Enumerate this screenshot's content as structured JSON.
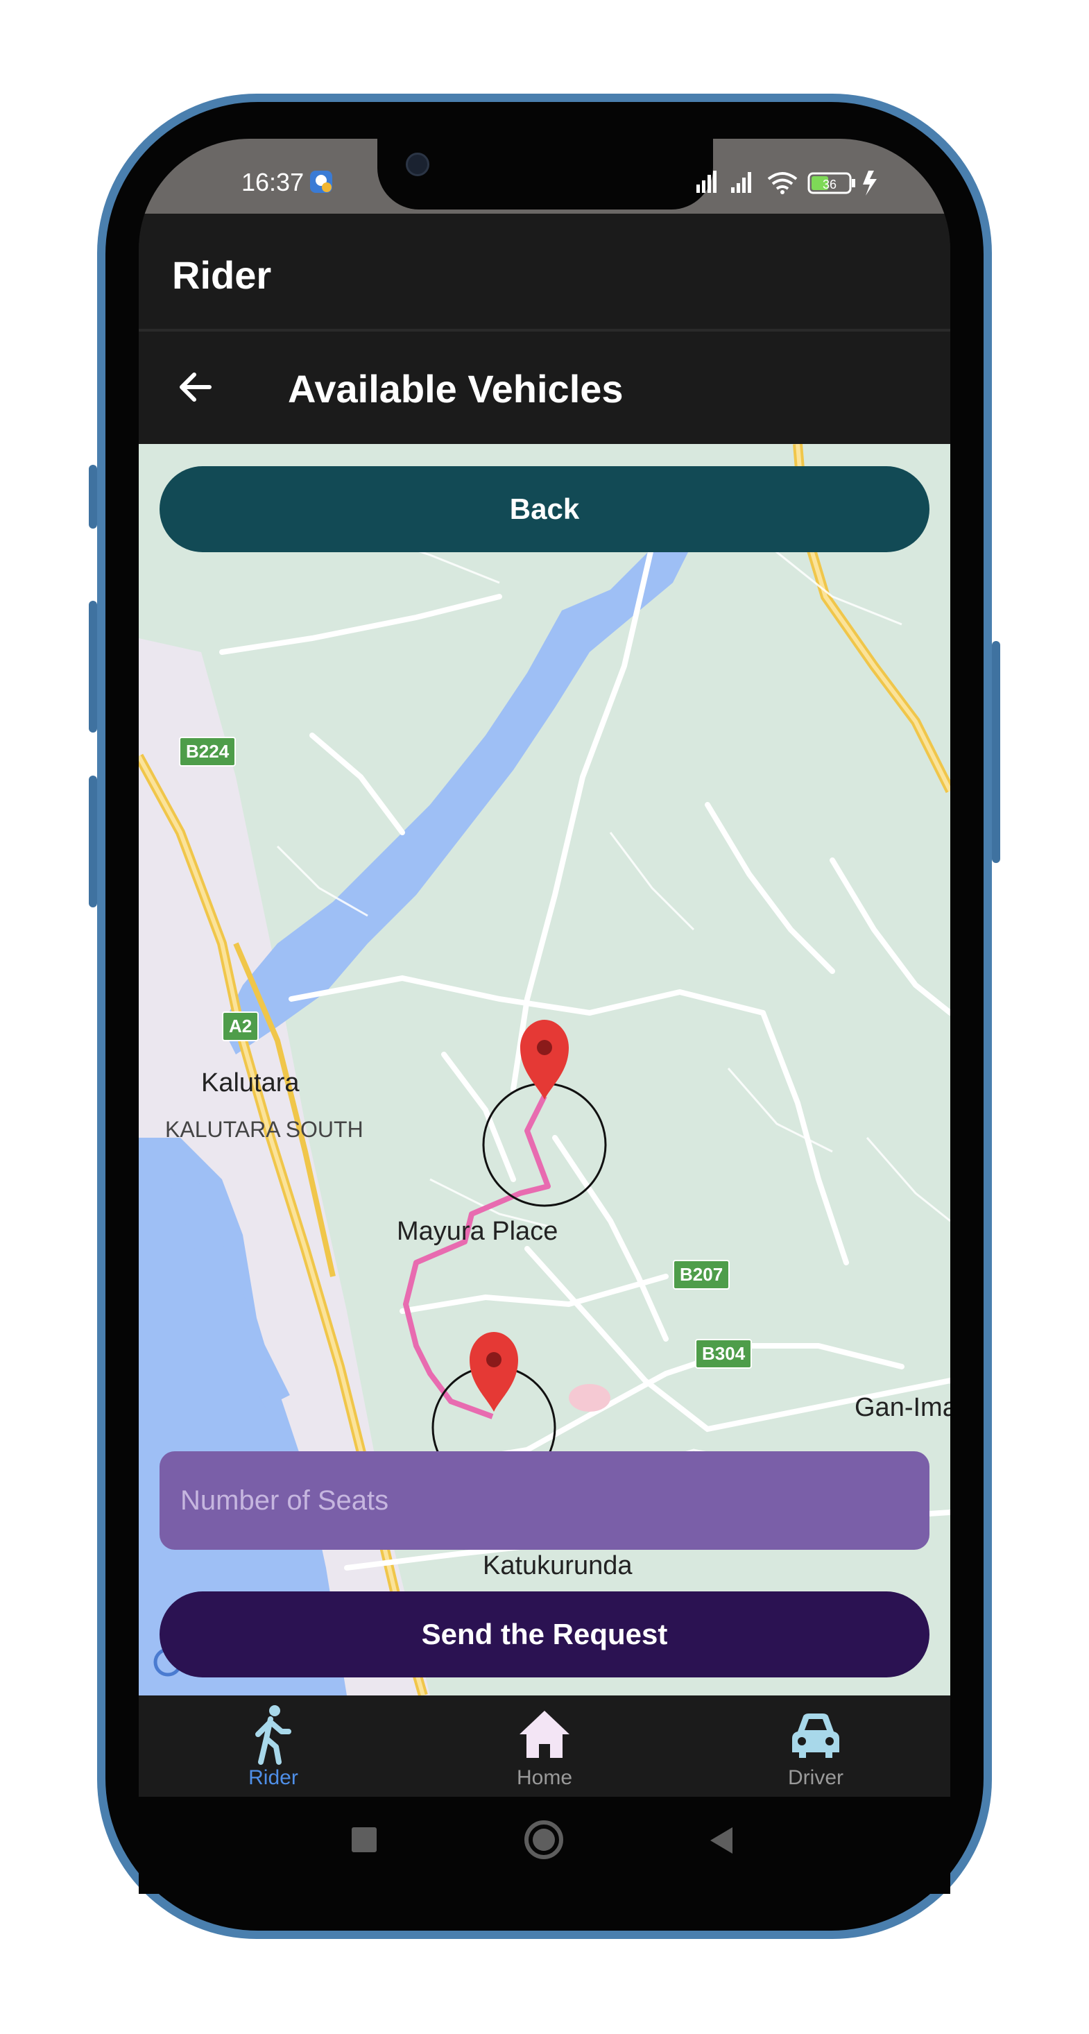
{
  "status_bar": {
    "time": "16:37",
    "battery": "36"
  },
  "app_bar": {
    "title": "Rider"
  },
  "sub_bar": {
    "title": "Available Vehicles"
  },
  "map": {
    "labels": {
      "kalutara": "Kalutara",
      "kalutara_south": "KALUTARA SOUTH",
      "mayura_place": "Mayura Place",
      "gan_ima": "Gan-Ima",
      "katukurunda": "Katukurunda"
    },
    "badges": {
      "b224": "B224",
      "a2": "A2",
      "b207": "B207",
      "b304": "B304"
    }
  },
  "actions": {
    "back_label": "Back",
    "seats_placeholder": "Number of Seats",
    "send_label": "Send the Request"
  },
  "bottom_nav": {
    "items": [
      {
        "label": "Rider",
        "active": true,
        "icon": "walking-person-icon"
      },
      {
        "label": "Home",
        "active": false,
        "icon": "home-icon"
      },
      {
        "label": "Driver",
        "active": false,
        "icon": "car-icon"
      }
    ]
  },
  "colors": {
    "back_button": "#124a55",
    "seats_input": "#7a5fa8",
    "send_button": "#2b1252",
    "route_line": "#e86bb0",
    "active_nav": "#4f8fe8"
  }
}
